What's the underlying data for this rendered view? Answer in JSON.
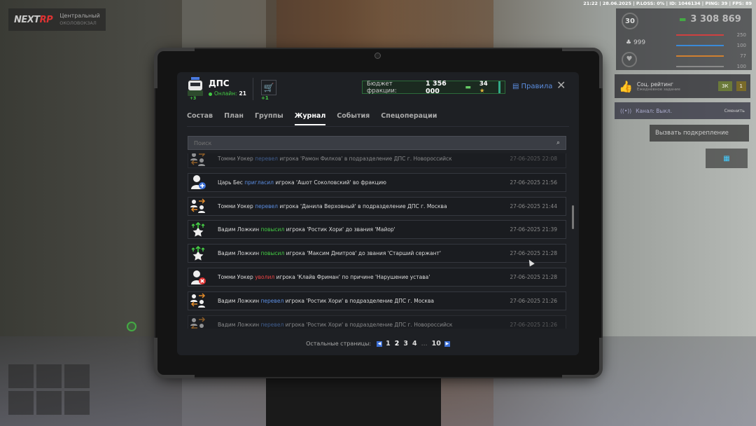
{
  "status_line": "21:22 | 28.06.2025 | P.LOSS: 0% | ID: 1046134 | PING: 39 | FPS: 89",
  "logo": {
    "brand_a": "NEXT",
    "brand_b": "RP",
    "region": "Центральный",
    "region_sub": "ОКОЛОВОКЗАЛ"
  },
  "hud": {
    "level": "30",
    "money": "3 308 869",
    "health_value": "999",
    "stats": [
      {
        "value": "250",
        "color": "#d04040"
      },
      {
        "value": "100",
        "color": "#3a8ad8"
      },
      {
        "value": "77",
        "color": "#d08030"
      },
      {
        "value": "100",
        "color": "#8a8a8a"
      }
    ],
    "social_title": "Соц. рейтинг",
    "social_sub": "Ежедневное задание",
    "social_chip": "3К",
    "social_chip2": "1",
    "channel_label": "Канал: Выкл.",
    "channel_switch": "Сменить",
    "backup_label": "Вызвать подкрепление"
  },
  "tablet": {
    "faction_name": "ДПС",
    "faction_badge": "+3",
    "online_label": "Онлайн:",
    "online_count": "21",
    "cart_badge": "+1",
    "budget_label": "Бюджет фракции:",
    "budget_value": "1 356 000",
    "stars_value": "34",
    "rules_label": "Правила",
    "close_label": "✕",
    "tabs": [
      "Состав",
      "План",
      "Группы",
      "Журнал",
      "События",
      "Спецоперации"
    ],
    "active_tab": "Журнал",
    "search_placeholder": "Поиск",
    "log": [
      {
        "type": "transfer",
        "who": "Томми Уокер",
        "action": "перевел",
        "action_color": "blue",
        "rest": "игрока 'Рамон Филков' в подразделение ДПС г. Новороссийск",
        "time": "27-06-2025 22:08"
      },
      {
        "type": "invite",
        "who": "Царь Бес",
        "action": "пригласил",
        "action_color": "blue",
        "rest": "игрока 'Ашот Соколовский' во фракцию",
        "time": "27-06-2025 21:56"
      },
      {
        "type": "transfer",
        "who": "Томми Уокер",
        "action": "перевел",
        "action_color": "blue",
        "rest": "игрока 'Данила Верховный' в подразделение ДПС г. Москва",
        "time": "27-06-2025 21:44"
      },
      {
        "type": "promote",
        "who": "Вадим Ложкин",
        "action": "повысил",
        "action_color": "green",
        "rest": "игрока 'Ростик Хори' до звания 'Майор'",
        "time": "27-06-2025 21:39"
      },
      {
        "type": "promote",
        "who": "Вадим Ложкин",
        "action": "повысил",
        "action_color": "green",
        "rest": "игрока 'Максим Дмитров' до звания 'Старший сержант'",
        "time": "27-06-2025 21:28"
      },
      {
        "type": "fire",
        "who": "Томми Уокер",
        "action": "уволил",
        "action_color": "red",
        "rest": "игрока 'Клайв Фриман' по причине 'Нарушение устава'",
        "time": "27-06-2025 21:28"
      },
      {
        "type": "transfer",
        "who": "Вадим Ложкин",
        "action": "перевел",
        "action_color": "blue",
        "rest": "игрока 'Ростик Хори' в подразделение ДПС г. Москва",
        "time": "27-06-2025 21:26"
      },
      {
        "type": "transfer",
        "who": "Вадим Ложкин",
        "action": "перевел",
        "action_color": "blue",
        "rest": "игрока 'Ростик Хори' в подразделение ДПС г. Новороссийск",
        "time": "27-06-2025 21:26"
      }
    ],
    "pager_label": "Остальные страницы:",
    "pages": [
      "1",
      "2",
      "3",
      "4",
      "...",
      "10"
    ],
    "current_page": "2"
  }
}
